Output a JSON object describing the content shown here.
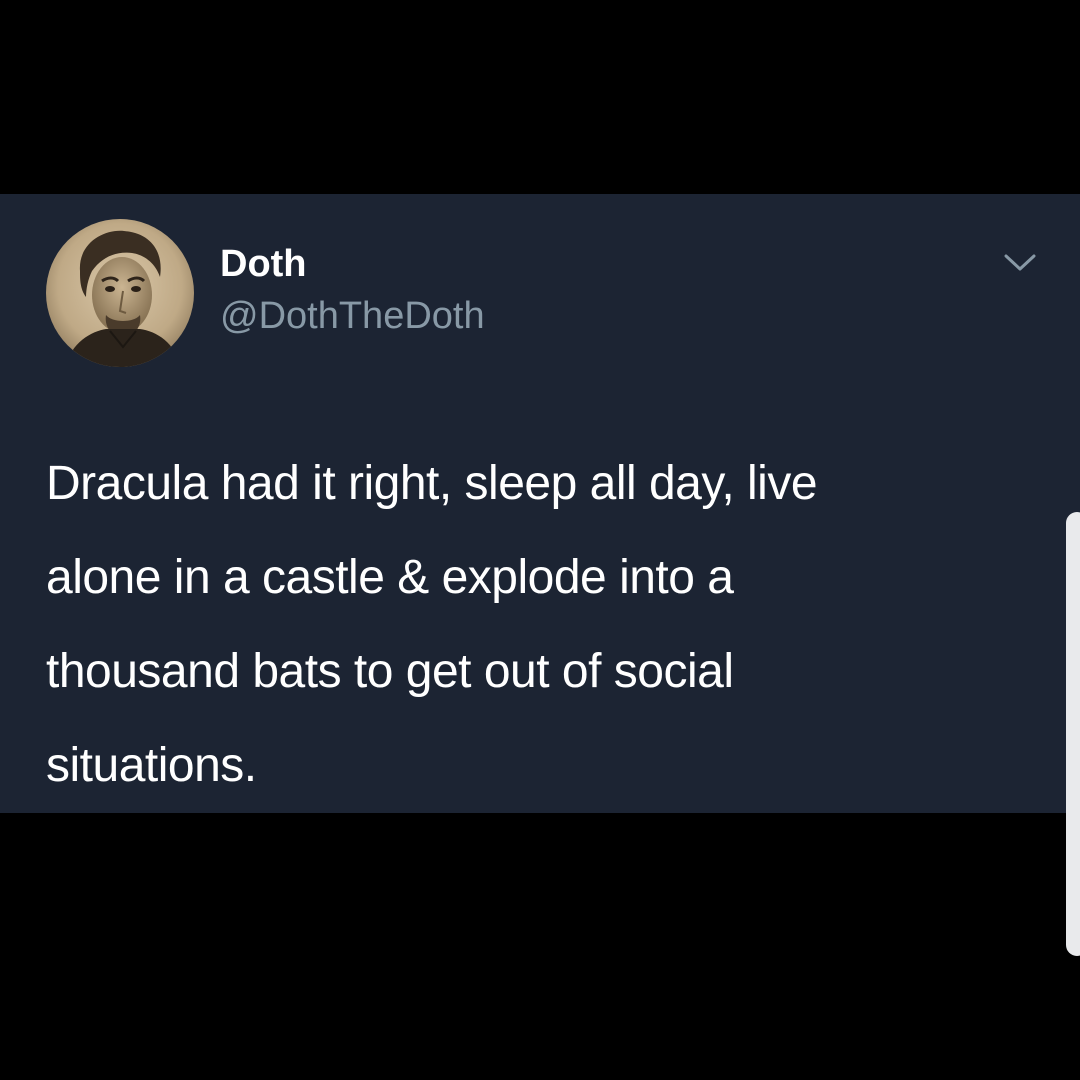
{
  "tweet": {
    "display_name": "Doth",
    "handle": "@DothTheDoth",
    "text_lines": [
      "Dracula had it right, sleep all day, live",
      "alone in a castle & explode into a",
      "thousand bats to get out of social",
      "situations."
    ],
    "menu_icon": "chevron-down-icon",
    "avatar_icon": "portrait-avatar"
  },
  "colors": {
    "page_background": "#000000",
    "card_background": "#1c2433",
    "primary_text": "#ffffff",
    "secondary_text": "#8899a6",
    "edge_panel": "#e9eaec"
  }
}
